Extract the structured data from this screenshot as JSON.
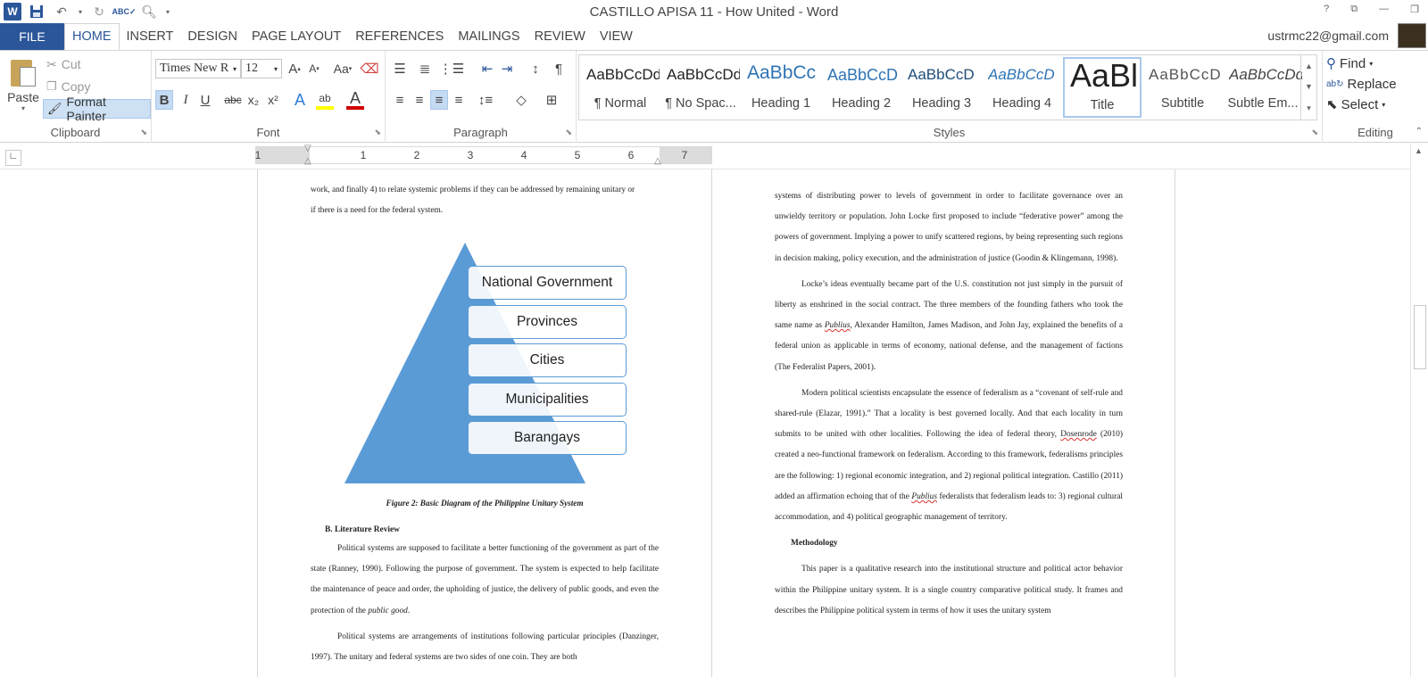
{
  "window": {
    "title": "CASTILLO APISA 11 - How United - Word",
    "controls": [
      "?",
      "⧉",
      "—",
      "❐"
    ]
  },
  "qat": {
    "logo": "W"
  },
  "tabs": {
    "file": "FILE",
    "items": [
      "HOME",
      "INSERT",
      "DESIGN",
      "PAGE LAYOUT",
      "REFERENCES",
      "MAILINGS",
      "REVIEW",
      "VIEW"
    ],
    "active": "HOME"
  },
  "user": {
    "email": "ustrmc22@gmail.com"
  },
  "clipboard": {
    "paste": "Paste",
    "cut": "Cut",
    "copy": "Copy",
    "format_painter": "Format Painter",
    "label": "Clipboard"
  },
  "font": {
    "name": "Times New R",
    "size": "12",
    "label": "Font",
    "grow": "A",
    "shrink": "A",
    "case": "Aa",
    "bold": "B",
    "italic": "I",
    "underline": "U",
    "strike": "abc",
    "subscript": "x₂",
    "superscript": "x²",
    "effects": "A",
    "highlight": "ab",
    "color": "A"
  },
  "paragraph": {
    "label": "Paragraph"
  },
  "styles": {
    "label": "Styles",
    "items": [
      {
        "preview": "AaBbCcDd",
        "name": "¶ Normal"
      },
      {
        "preview": "AaBbCcDd",
        "name": "¶ No Spac..."
      },
      {
        "preview": "AaBbCc",
        "name": "Heading 1"
      },
      {
        "preview": "AaBbCcD",
        "name": "Heading 2"
      },
      {
        "preview": "AaBbCcD",
        "name": "Heading 3"
      },
      {
        "preview": "AaBbCcD",
        "name": "Heading 4"
      },
      {
        "preview": "AaBl",
        "name": "Title"
      },
      {
        "preview": "AaBbCcD",
        "name": "Subtitle"
      },
      {
        "preview": "AaBbCcDd",
        "name": "Subtle Em..."
      }
    ],
    "selected": "Title"
  },
  "editing": {
    "label": "Editing",
    "find": "Find",
    "replace": "Replace",
    "select": "Select"
  },
  "ruler": {
    "numbers": [
      "1",
      "1",
      "2",
      "3",
      "4",
      "5",
      "6",
      "7"
    ]
  },
  "page_left": {
    "intro_line1": "work, and finally 4) to relate systemic problems if they can be addressed by remaining unitary or",
    "intro_line2": "if there is a need for the federal system.",
    "diagram_levels": [
      "National Government",
      "Provinces",
      "Cities",
      "Municipalities",
      "Barangays"
    ],
    "caption": "Figure 2: Basic Diagram of the Philippine Unitary System",
    "section_heading": "B.  Literature Review",
    "para1": "Political systems are supposed to facilitate a better functioning of the government as part of the state (Ranney, 1990).  Following the purpose of government.  The system is expected to help facilitate the maintenance of peace and order, the upholding of justice, the delivery of public goods, and even the protection of the ",
    "para1_italic": "public good",
    "para1_end": ".",
    "para2": "Political systems are arrangements of institutions following particular principles (Danzinger, 1997).  The unitary and federal systems are two sides of one coin.  They are both"
  },
  "page_right": {
    "p1": "systems of distributing power to levels of government in order to facilitate governance over an unwieldy territory or population.  John Locke first proposed to include “federative power” among the powers of government.  Implying a power to unify scattered regions, by being representing such regions in decision making, policy execution, and the administration of justice (Goodin & Klingemann, 1998).",
    "p2_a": "Locke’s ideas eventually became part of the U.S. constitution not just simply in the pursuit of liberty as enshrined in the social contract.  The three members of the founding fathers who took the same name as ",
    "p2_publius": "Publius",
    "p2_b": ", Alexander Hamilton, James Madison, and John Jay, explained the benefits of a federal union as applicable in terms of economy, national defense, and the management of factions (The Federalist Papers, 2001).",
    "p3_a": "Modern political scientists encapsulate the essence of federalism as a “covenant of self-rule and shared-rule (Elazar, 1991).”  That a locality is best governed locally.  And that each locality in turn submits to be united with other localities.  Following the idea of federal theory, ",
    "p3_dosenrode": "Dosenrode",
    "p3_b": " (2010) created a neo-functional framework on federalism.  According to this framework, federalisms principles are the following:  1) regional economic integration, and 2) regional political integration.  Castillo (2011) added an affirmation echoing that of the ",
    "p3_publius": "Publius",
    "p3_c": " federalists that federalism leads to:  3) regional cultural accommodation, and 4) political geographic management of territory.",
    "methodology_heading": "Methodology",
    "p4": "This paper is a qualitative research into the institutional structure and political actor behavior within the Philippine unitary system.  It is a single country comparative political study.  It frames and describes the Philippine political system in terms of how it uses the unitary system"
  }
}
